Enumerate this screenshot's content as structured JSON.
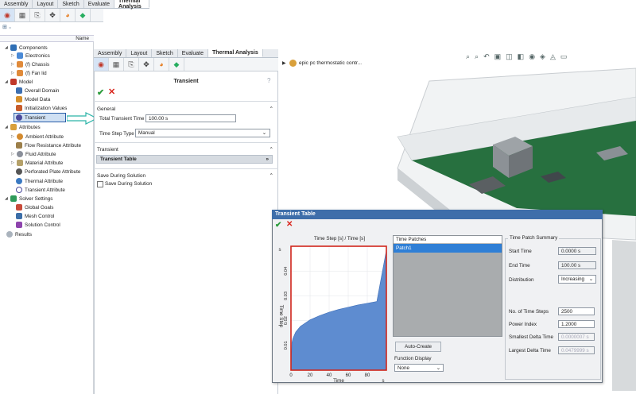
{
  "top_window": {
    "tabs": [
      "Assembly",
      "Layout",
      "Sketch",
      "Evaluate",
      "Thermal Analysis"
    ],
    "active_tab": "Thermal Analysis",
    "name_header": "Name"
  },
  "tree": {
    "items": [
      {
        "label": "Components"
      },
      {
        "label": "Electronics"
      },
      {
        "label": "(f) Chassis"
      },
      {
        "label": "(f) Fan lid"
      },
      {
        "label": "Model"
      },
      {
        "label": "Overall Domain"
      },
      {
        "label": "Model Data"
      },
      {
        "label": "Initialization Values"
      },
      {
        "label": "Transient"
      },
      {
        "label": "Attributes"
      },
      {
        "label": "Ambient Attribute"
      },
      {
        "label": "Flow Resistance Attribute"
      },
      {
        "label": "Fluid Attribute"
      },
      {
        "label": "Material Attribute"
      },
      {
        "label": "Perforated Plate Attribute"
      },
      {
        "label": "Thermal Attribute"
      },
      {
        "label": "Transient Attribute"
      },
      {
        "label": "Solver Settings"
      },
      {
        "label": "Global Goals"
      },
      {
        "label": "Mesh Control"
      },
      {
        "label": "Solution Control"
      },
      {
        "label": "Results"
      }
    ]
  },
  "panel": {
    "tabs": [
      "Assembly",
      "Layout",
      "Sketch",
      "Evaluate",
      "Thermal Analysis"
    ],
    "active_tab": "Thermal Analysis",
    "title": "Transient",
    "general_header": "General",
    "total_time_label": "Total Transient Time",
    "total_time_value": "100.00 s",
    "step_type_label": "Time Step Type",
    "step_type_value": "Manual",
    "transient_header": "Transient",
    "transient_table_label": "Transient Table",
    "save_header": "Save During Solution",
    "save_checkbox_label": "Save During Solution"
  },
  "viewport": {
    "breadcrumb": "epic pc thermostatic contr..."
  },
  "dialog": {
    "title": "Transient Table",
    "chart_title": "Time Step [s] / Time [s]",
    "patches_header": "Time Patches",
    "patches": [
      "Patch1"
    ],
    "auto_create_label": "Auto-Create",
    "function_display_label": "Function Display",
    "function_display_value": "None",
    "summary_header": "Time Patch Summary",
    "start_time_label": "Start Time",
    "start_time_value": "0.0000 s",
    "end_time_label": "End Time",
    "end_time_value": "100.00 s",
    "distribution_label": "Distribution",
    "distribution_value": "Increasing",
    "num_steps_label": "No. of Time Steps",
    "num_steps_value": "2500",
    "power_index_label": "Power Index",
    "power_index_value": "1.2000",
    "smallest_dt_label": "Smallest Delta Time",
    "smallest_dt_value": "0.0000007 s",
    "largest_dt_label": "Largest Delta Time",
    "largest_dt_value": "0.0479999 s"
  },
  "chart_data": {
    "type": "area",
    "title": "Time Step [s] / Time [s]",
    "xlabel": "Time",
    "ylabel": "Time Step",
    "x_unit": "s",
    "y_unit": "s",
    "xlim": [
      0,
      100
    ],
    "ylim": [
      0,
      0.05
    ],
    "x_ticks": [
      0,
      20,
      40,
      60,
      80
    ],
    "y_ticks": [
      0.01,
      0.02,
      0.03,
      0.04
    ],
    "x": [
      0,
      1,
      2,
      5,
      10,
      20,
      30,
      40,
      50,
      60,
      70,
      80,
      90,
      100
    ],
    "y": [
      0,
      0.0111,
      0.0128,
      0.0154,
      0.0177,
      0.0203,
      0.022,
      0.0234,
      0.0245,
      0.0254,
      0.0263,
      0.027,
      0.0277,
      0.0484
    ]
  }
}
